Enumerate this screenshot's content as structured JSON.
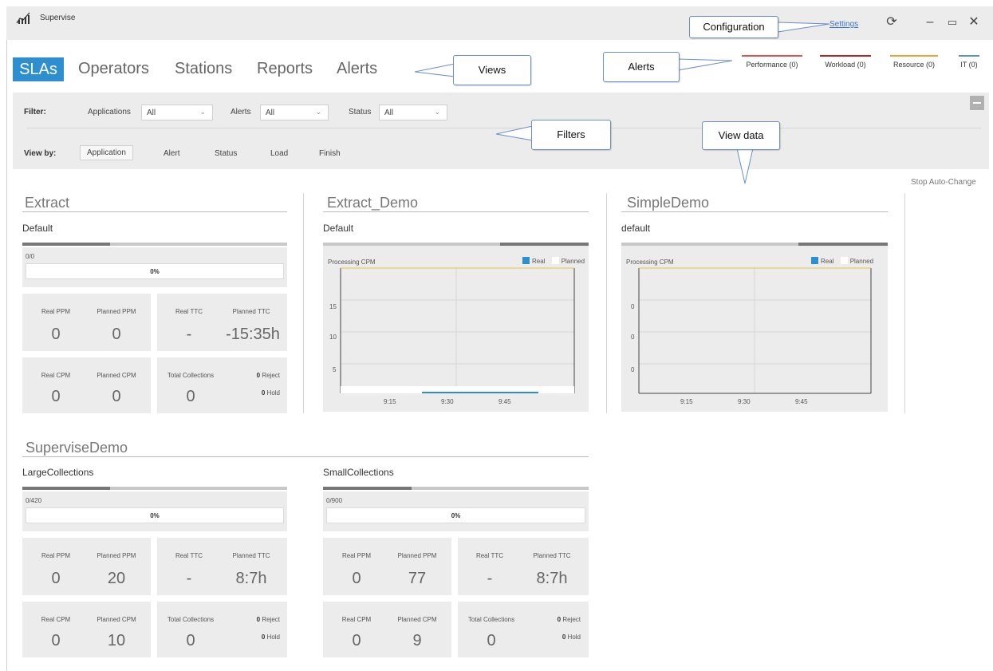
{
  "window": {
    "title": "Supervise",
    "settings_link": "Settings",
    "icon": "bar-chart-logo-icon",
    "controls": {
      "refresh": "⟳",
      "minimize": "–",
      "maximize": "▭",
      "close": "✕"
    }
  },
  "nav": {
    "tabs": [
      {
        "label": "SLAs",
        "active": true
      },
      {
        "label": "Operators"
      },
      {
        "label": "Stations"
      },
      {
        "label": "Reports"
      },
      {
        "label": "Alerts"
      }
    ]
  },
  "alert_categories": [
    {
      "label": "Performance (0)",
      "color": "#e05252"
    },
    {
      "label": "Workload (0)",
      "color": "#b02424"
    },
    {
      "label": "Resource (0)",
      "color": "#f0a23a"
    },
    {
      "label": "IT (0)",
      "color": "#5a8fd6"
    }
  ],
  "filter": {
    "label": "Filter:",
    "applications_label": "Applications",
    "applications_value": "All",
    "alerts_label": "Alerts",
    "alerts_value": "All",
    "status_label": "Status",
    "status_value": "All",
    "view_by_label": "View by:",
    "view_by_options": [
      "Application",
      "Alert",
      "Status",
      "Load",
      "Finish"
    ],
    "view_by_selected": "Application"
  },
  "stop_auto_change": "Stop Auto-Change",
  "callouts": {
    "configuration": "Configuration",
    "views": "Views",
    "alerts": "Alerts",
    "filters": "Filters",
    "view_data": "View data"
  },
  "colors": {
    "accent": "#2e8fd0",
    "planned_line": "#f0c040"
  },
  "apps": [
    {
      "name": "Extract",
      "sla": {
        "name": "Default",
        "ratio": "0/0",
        "percent": "0%",
        "progress": 0,
        "metrics": {
          "real_ppm_label": "Real PPM",
          "real_ppm": "0",
          "planned_ppm_label": "Planned PPM",
          "planned_ppm": "0",
          "real_ttc_label": "Real TTC",
          "real_ttc": "-",
          "planned_ttc_label": "Planned TTC",
          "planned_ttc": "-15:35h",
          "real_cpm_label": "Real CPM",
          "real_cpm": "0",
          "planned_cpm_label": "Planned CPM",
          "planned_cpm": "0",
          "total_collections_label": "Total Collections",
          "total_collections": "0",
          "reject_count": "0",
          "reject_label": "Reject",
          "hold_count": "0",
          "hold_label": "Hold"
        }
      }
    },
    {
      "name": "Extract_Demo",
      "sla": {
        "name": "Default",
        "chart_title": "Processing CPM",
        "legend_real": "Real",
        "legend_planned": "Planned",
        "y_ticks": [
          "15",
          "10",
          "5"
        ],
        "x_ticks": [
          "9:15",
          "9:30",
          "9:45"
        ]
      }
    },
    {
      "name": "SimpleDemo",
      "sla": {
        "name": "default",
        "chart_title": "Processing CPM",
        "legend_real": "Real",
        "legend_planned": "Planned",
        "y_ticks": [
          "0",
          "0",
          "0"
        ],
        "x_ticks": [
          "9:15",
          "9:30",
          "9:45"
        ]
      }
    },
    {
      "name": "SuperviseDemo",
      "slas": [
        {
          "name": "LargeCollections",
          "ratio": "0/420",
          "percent": "0%",
          "progress": 0,
          "metrics": {
            "real_ppm_label": "Real PPM",
            "real_ppm": "0",
            "planned_ppm_label": "Planned PPM",
            "planned_ppm": "20",
            "real_ttc_label": "Real TTC",
            "real_ttc": "-",
            "planned_ttc_label": "Planned TTC",
            "planned_ttc": "8:7h",
            "real_cpm_label": "Real CPM",
            "real_cpm": "0",
            "planned_cpm_label": "Planned CPM",
            "planned_cpm": "10",
            "total_collections_label": "Total Collections",
            "total_collections": "0",
            "reject_count": "0",
            "reject_label": "Reject",
            "hold_count": "0",
            "hold_label": "Hold"
          }
        },
        {
          "name": "SmallCollections",
          "ratio": "0/900",
          "percent": "0%",
          "progress": 0,
          "metrics": {
            "real_ppm_label": "Real PPM",
            "real_ppm": "0",
            "planned_ppm_label": "Planned PPM",
            "planned_ppm": "77",
            "real_ttc_label": "Real TTC",
            "real_ttc": "-",
            "planned_ttc_label": "Planned TTC",
            "planned_ttc": "8:7h",
            "real_cpm_label": "Real CPM",
            "real_cpm": "0",
            "planned_cpm_label": "Planned CPM",
            "planned_cpm": "9",
            "total_collections_label": "Total Collections",
            "total_collections": "0",
            "reject_count": "0",
            "reject_label": "Reject",
            "hold_count": "0",
            "hold_label": "Hold"
          }
        }
      ]
    }
  ]
}
